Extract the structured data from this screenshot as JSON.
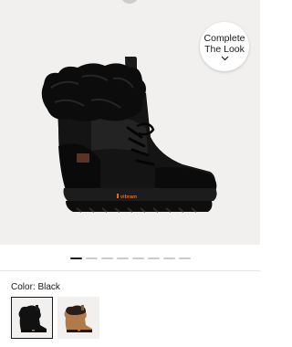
{
  "product": {
    "complete_look_line1": "Complete",
    "complete_look_line2": "The Look",
    "sole_brand": "vibram"
  },
  "carousel": {
    "total": 8,
    "active": 1
  },
  "color": {
    "label": "Color: Black",
    "swatches": [
      {
        "name": "Black",
        "selected": true
      },
      {
        "name": "Chestnut",
        "selected": false
      }
    ]
  },
  "colors": {
    "gallery_bg": "#f1f0ee",
    "boot_black": "#111111",
    "sole_accent": "#e06a1b",
    "chestnut": "#b07a4a"
  }
}
